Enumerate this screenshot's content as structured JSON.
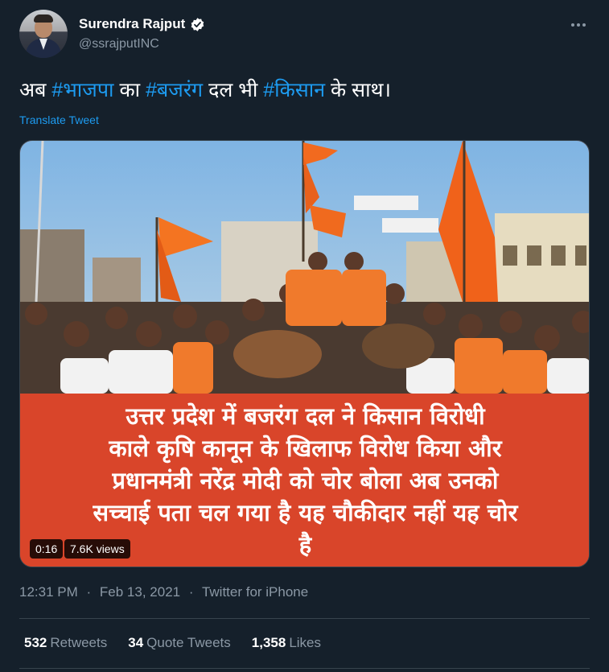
{
  "author": {
    "display_name": "Surendra Rajput",
    "handle": "@ssrajputINC",
    "verified": true
  },
  "tweet": {
    "text_parts": [
      {
        "text": "अब ",
        "hashtag": false
      },
      {
        "text": "#भाजपा",
        "hashtag": true
      },
      {
        "text": " का ",
        "hashtag": false
      },
      {
        "text": "#बजरंग",
        "hashtag": true
      },
      {
        "text": " दल भी ",
        "hashtag": false
      },
      {
        "text": "#किसान",
        "hashtag": true
      },
      {
        "text": " के साथ।",
        "hashtag": false
      }
    ],
    "translate_label": "Translate Tweet"
  },
  "media": {
    "caption_lines": [
      "उत्तर प्रदेश में बजरंग दल ने किसान विरोधी",
      "काले कृषि कानून के खिलाफ विरोध किया और",
      "प्रधानमंत्री नरेंद्र मोदी को चोर बोला अब उनको",
      "सच्चाई पता चल गया है यह चौकीदार नहीं यह चोर",
      "है"
    ],
    "duration": "0:16",
    "views": "7.6K views"
  },
  "meta": {
    "time": "12:31 PM",
    "date": "Feb 13, 2021",
    "source": "Twitter for iPhone",
    "separator": "·"
  },
  "stats": {
    "retweets_count": "532",
    "retweets_label": "Retweets",
    "quotes_count": "34",
    "quotes_label": "Quote Tweets",
    "likes_count": "1,358",
    "likes_label": "Likes"
  },
  "colors": {
    "background": "#15202b",
    "link": "#1d9bf0",
    "muted": "#8b98a5",
    "banner": "#d9452a"
  }
}
